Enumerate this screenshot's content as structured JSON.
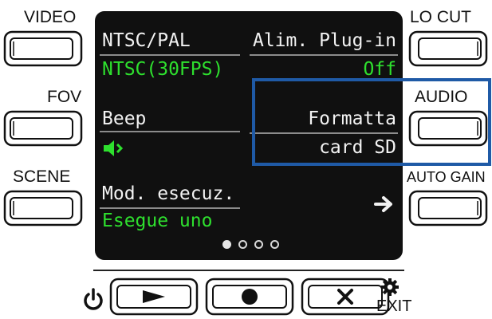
{
  "left_buttons": [
    {
      "label": "VIDEO"
    },
    {
      "label": "FOV"
    },
    {
      "label": "SCENE"
    }
  ],
  "right_buttons": [
    {
      "label": "LO CUT"
    },
    {
      "label": "AUDIO"
    },
    {
      "label": "AUTO GAIN"
    }
  ],
  "screen": {
    "items": [
      {
        "label": "NTSC/PAL",
        "value": "NTSC(30FPS)"
      },
      {
        "label": "Alim. Plug-in",
        "value": "Off"
      },
      {
        "label": "Beep",
        "value_icon": "speaker-icon"
      },
      {
        "label_line1": "Formatta",
        "label_line2": "card SD"
      },
      {
        "label": "Mod. esecuz.",
        "value": "Esegue uno"
      }
    ],
    "next_arrow": "➜",
    "page_indicator": {
      "total": 4,
      "current": 1
    }
  },
  "bottom": {
    "exit_label": "EXIT",
    "icons": [
      "power-icon",
      "play-icon",
      "record-icon",
      "delete-icon",
      "gear-icon"
    ]
  },
  "colors": {
    "screen_bg": "#101010",
    "value_green": "#2ee02e",
    "highlight_blue": "#1f5aa6"
  }
}
